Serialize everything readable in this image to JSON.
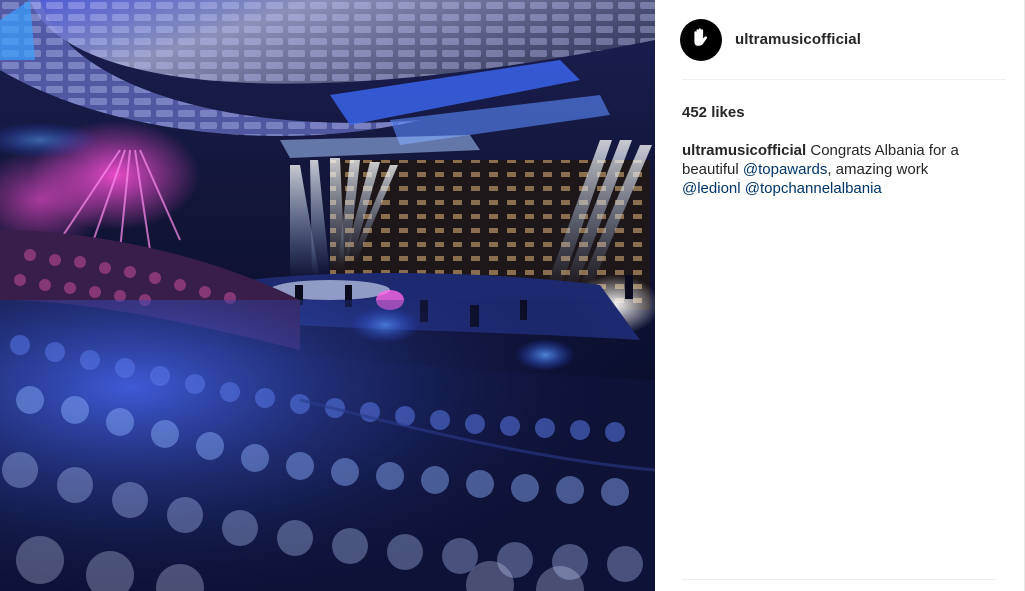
{
  "post": {
    "username": "ultramusicofficial",
    "likes": "452 likes",
    "caption": {
      "username": "ultramusicofficial",
      "text_1": "Congrats Albania for a beautiful",
      "mention_1": "@topawards",
      "text_2": ", amazing work",
      "mention_2": "@ledionl",
      "mention_3": "@topchannelalbania"
    }
  },
  "colors": {
    "text": "#262626",
    "mention": "#003569",
    "divider": "#efefef",
    "avatar_bg": "#000000"
  },
  "icons": {
    "avatar": "ultra-hand-logo-icon"
  }
}
